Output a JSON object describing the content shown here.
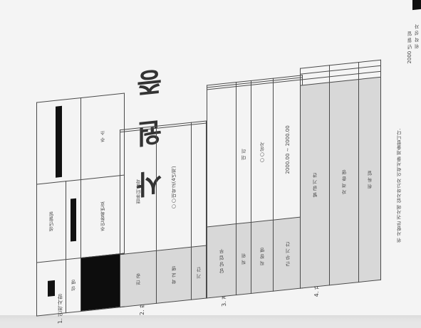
{
  "doc": {
    "title": "사 원 증",
    "section1": "1. 인적사항",
    "section2": "2. 학력사항",
    "section3": "3. 경력사항",
    "section4": "4. 자격증",
    "personal": {
      "name_label": "성 명",
      "ssn_label": "주민등록번호",
      "address_label": "주 소",
      "resident_label": "생년월일"
    },
    "education": {
      "headers": [
        "기 간",
        "학 교 명",
        "전 공"
      ],
      "row1": {
        "period": "",
        "school": "○○대학교(4년제)",
        "major": "컴퓨터공학"
      }
    },
    "career": {
      "headers": [
        "근 무 기 간",
        "직 장 명",
        "직 위",
        "담 당 업 무"
      ],
      "row1": {
        "period": "2000.00 ~ 2000.00",
        "company": "○○상사",
        "position": "대 리",
        "duty": ""
      }
    },
    "license": {
      "headers": [
        "취 득 일",
        "자 격 증 명",
        "발 급 기 관"
      ]
    },
    "footer": {
      "statement": "위 사람은 귀사에 입사하고자 이력서를 제출합니다.",
      "date": "2000 년 월 일",
      "signature_label": "위 작 성 자"
    }
  }
}
